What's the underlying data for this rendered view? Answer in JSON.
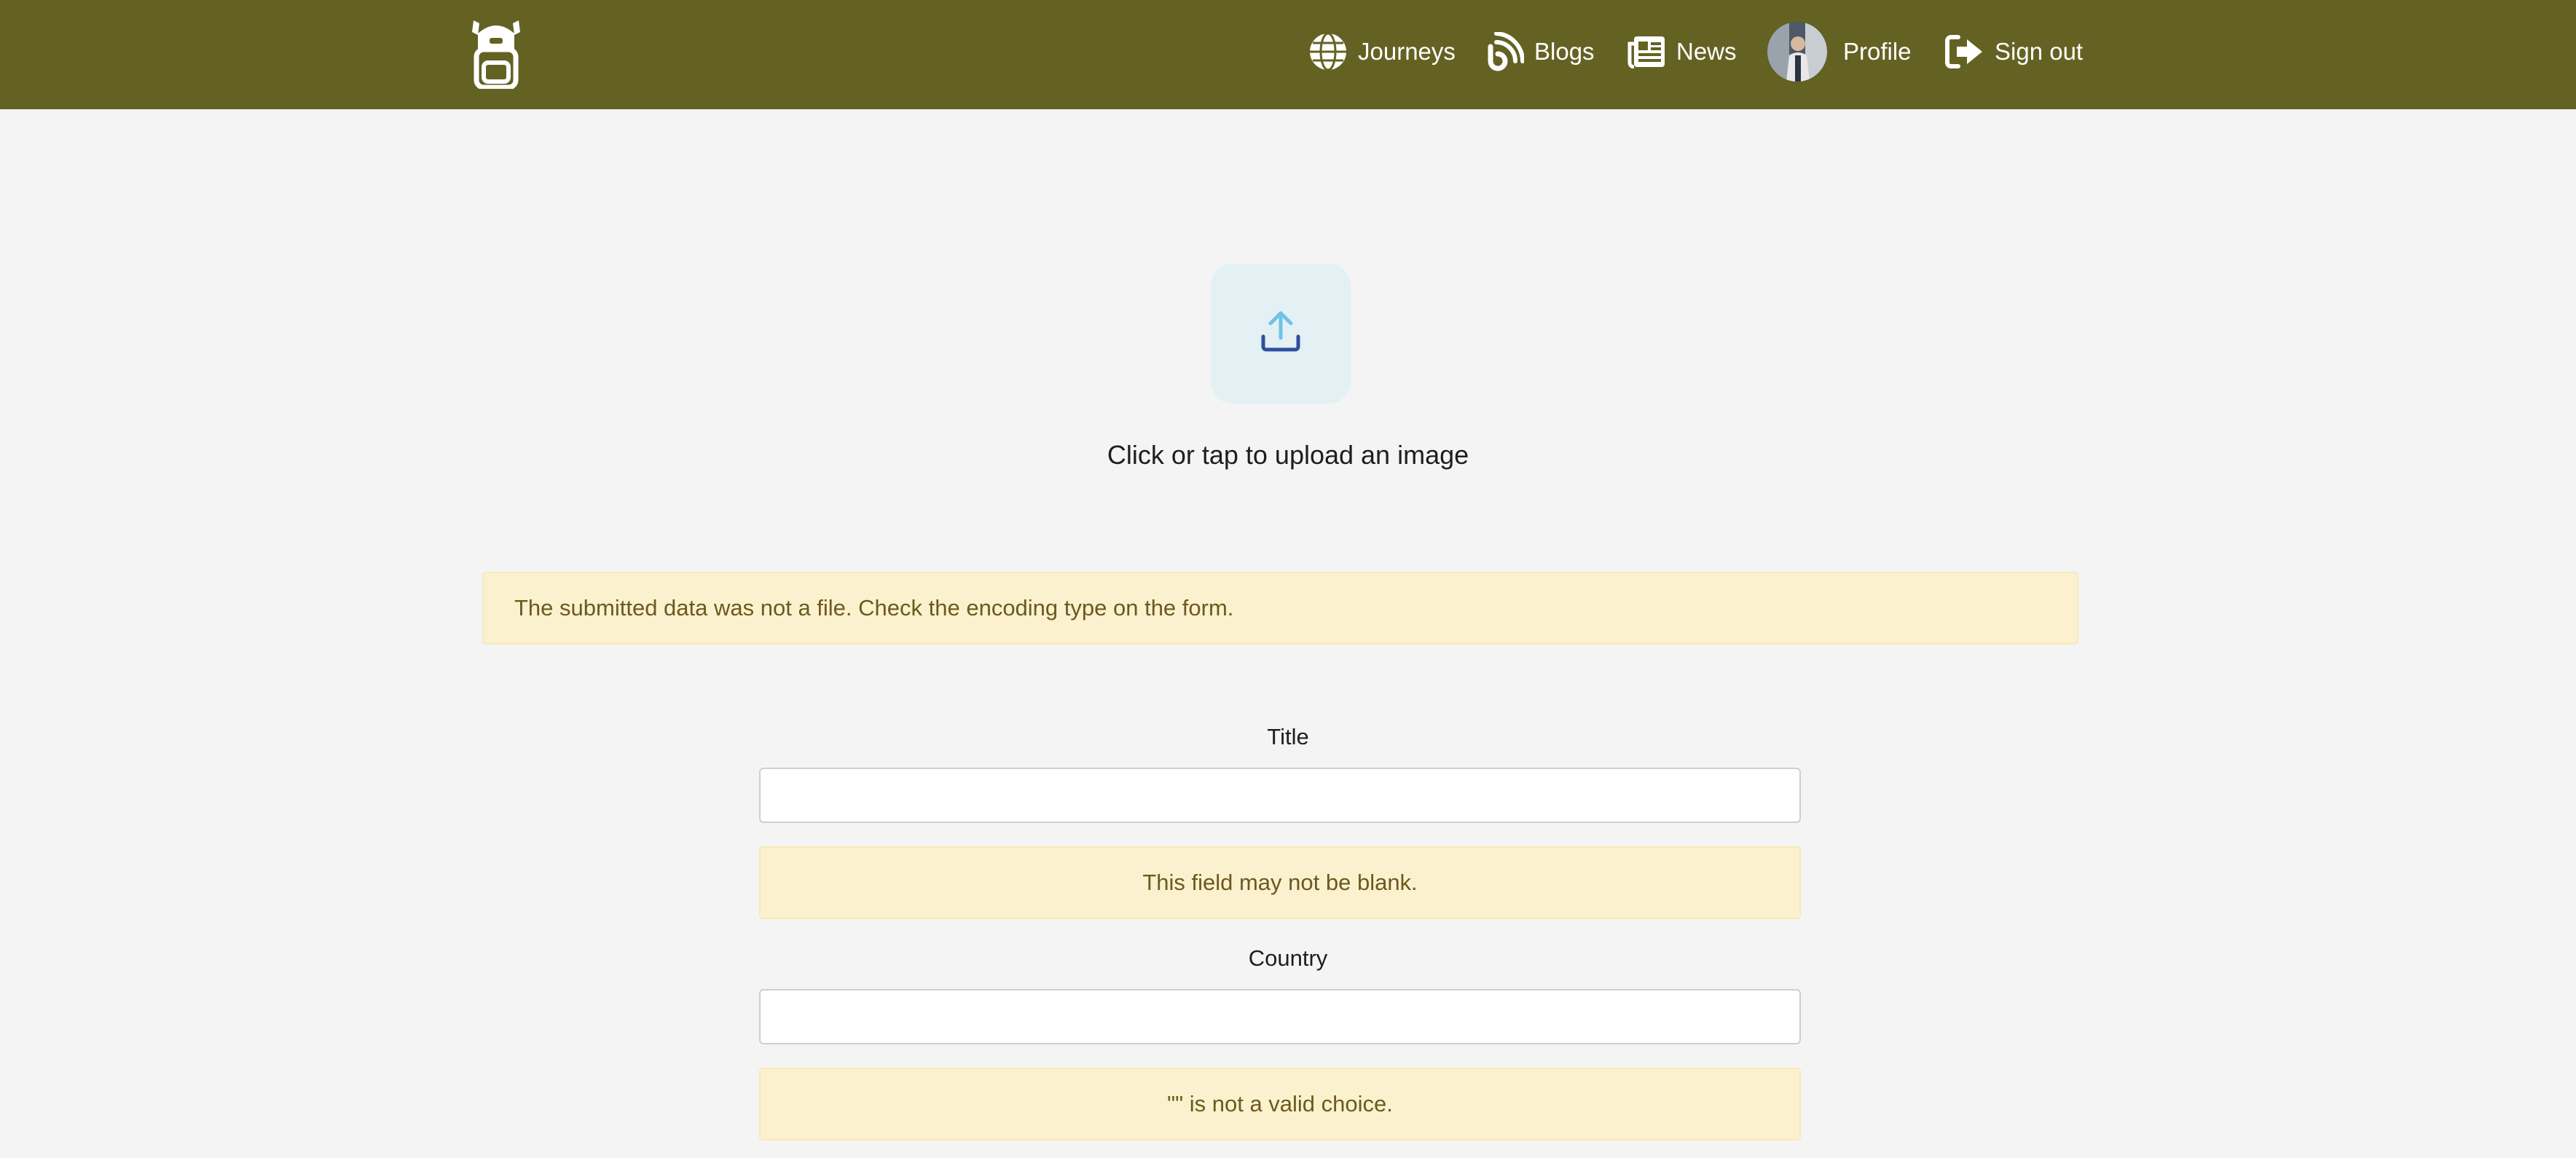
{
  "navbar": {
    "brand_icon": "backpack-icon",
    "background": "#646222",
    "items": [
      {
        "label": "Journeys",
        "icon": "globe-icon"
      },
      {
        "label": "Blogs",
        "icon": "blog-icon"
      },
      {
        "label": "News",
        "icon": "newspaper-icon"
      },
      {
        "label": "Profile",
        "icon": "avatar"
      },
      {
        "label": "Sign out",
        "icon": "sign-out-icon"
      }
    ]
  },
  "upload": {
    "icon": "upload-icon",
    "text": "Click or tap to upload an image"
  },
  "alerts": {
    "file_error": "The submitted data was not a file. Check the encoding type on the form."
  },
  "form": {
    "title": {
      "label": "Title",
      "value": "",
      "error": "This field may not be blank."
    },
    "country": {
      "label": "Country",
      "value": "",
      "error": "\"\" is not a valid choice."
    }
  },
  "colors": {
    "alert_bg": "#fcf1cf",
    "alert_text": "#6b5a1d",
    "upload_bg": "#e3f0f4",
    "upload_icon_arrow": "#6ec3e6",
    "upload_icon_tray": "#2f4f9e"
  }
}
